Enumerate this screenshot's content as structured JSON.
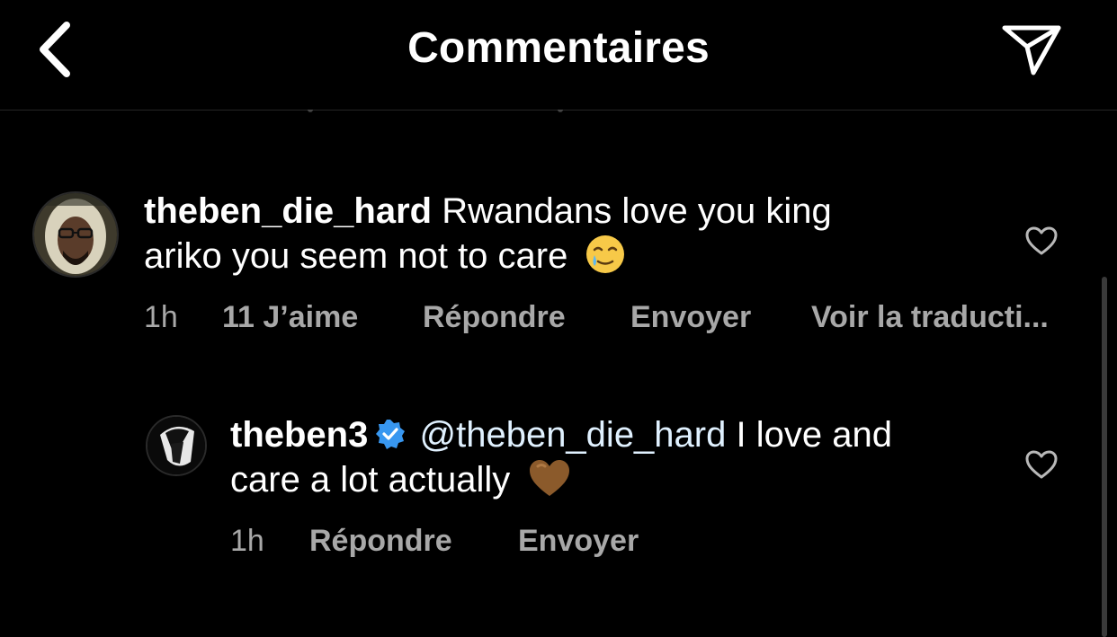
{
  "header": {
    "title": "Commentaires",
    "back_icon": "chevron-left-icon",
    "share_icon": "paper-plane-icon"
  },
  "comments": [
    {
      "username": "theben_die_hard",
      "text_line1": "Rwandans love you king",
      "text_line2": "ariko you seem not to care",
      "emoji": "crying-smile-emoji",
      "time": "1h",
      "likes": "11 J’aime",
      "reply": "Répondre",
      "send": "Envoyer",
      "translate": "Voir la traducti..."
    }
  ],
  "reply": {
    "username": "theben3",
    "verified": true,
    "mention": "@theben_die_hard",
    "text_line1_rest": "I love and",
    "text_line2": "care a lot actually",
    "emoji": "brown-heart-emoji",
    "time": "1h",
    "reply": "Répondre",
    "send": "Envoyer"
  },
  "colors": {
    "background": "#000000",
    "text": "#ffffff",
    "meta": "#a8a8a8",
    "mention": "#e0f1ff",
    "verified": "#3897f0",
    "brown_heart": "#8b5a2b"
  }
}
